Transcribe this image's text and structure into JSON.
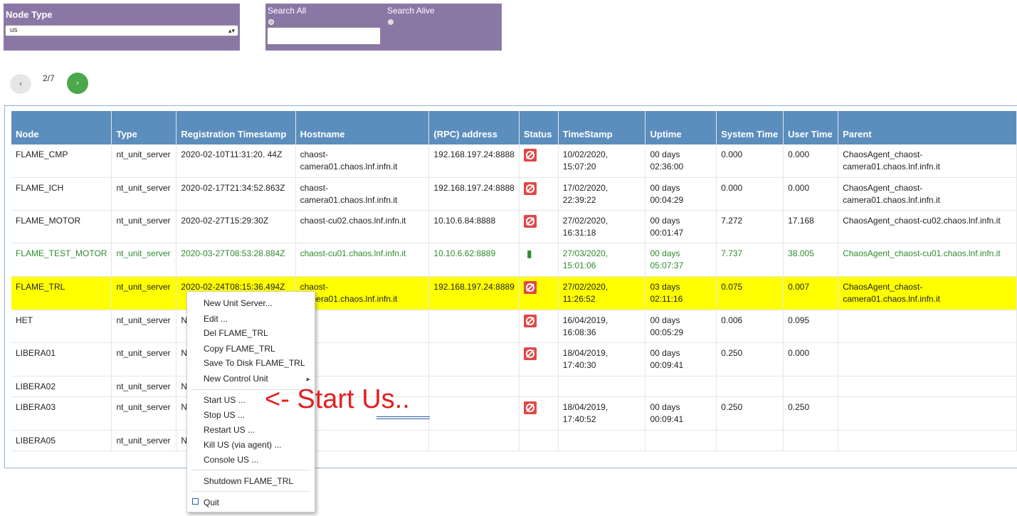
{
  "filters": {
    "node_type_label": "Node Type",
    "node_type_value": "us",
    "search_all_label": "Search All",
    "search_alive_label": "Search Alive",
    "search_value": ""
  },
  "pagination": {
    "prev": "‹",
    "page_text": "2/7",
    "next": "›"
  },
  "table": {
    "headers": [
      "Node",
      "Type",
      "Registration Timestamp",
      "Hostname",
      "(RPC) address",
      "Status",
      "TimeStamp",
      "Uptime",
      "System Time",
      "User Time",
      "Parent"
    ],
    "rows": [
      {
        "node": "FLAME_CMP",
        "type": "nt_unit_server",
        "reg": "2020-02-10T11:31:20. 44Z",
        "host": "chaost-camera01.chaos.lnf.infn.it",
        "rpc": "192.168.197.24:8888",
        "status": "stop-icon",
        "ts": "10/02/2020, 15:07:20",
        "uptime": "00 days 02:36:00",
        "sys": "0.000",
        "user": "0.000",
        "parent": "ChaosAgent_chaost-camera01.chaos.lnf.infn.it"
      },
      {
        "node": "FLAME_ICH",
        "type": "nt_unit_server",
        "reg": "2020-02-17T21:34:52.863Z",
        "host": "chaost-camera01.chaos.lnf.infn.it",
        "rpc": "192.168.197.24:8888",
        "status": "stop-icon",
        "ts": "17/02/2020, 22:39:22",
        "uptime": "00 days 00:04:29",
        "sys": "0.000",
        "user": "0.000",
        "parent": "ChaosAgent_chaost-camera01.chaos.lnf.infn.it"
      },
      {
        "node": "FLAME_MOTOR",
        "type": "nt_unit_server",
        "reg": "2020-02-27T15:29:30Z",
        "host": "chaost-cu02.chaos.lnf.infn.it",
        "rpc": "10.10.6.84:8888",
        "status": "stop-icon",
        "ts": "27/02/2020, 16:31:18",
        "uptime": "00 days 00:01:47",
        "sys": "7.272",
        "user": "17.168",
        "parent": "ChaosAgent_chaost-cu02.chaos.lnf.infn.it"
      },
      {
        "node": "FLAME_TEST_MOTOR",
        "type": "nt_unit_server",
        "reg": "2020-03-27T08:53:28.884Z",
        "host": "chaost-cu01.chaos.lnf.infn.it",
        "rpc": "10.10.6.62:8889",
        "status": "plug-icon",
        "ts": "27/03/2020, 15:01:06",
        "uptime": "00 days 05:07:37",
        "sys": "7.737",
        "user": "38.005",
        "parent": "ChaosAgent_chaost-cu01.chaos.lnf.infn.it"
      },
      {
        "node": "FLAME_TRL",
        "type": "nt_unit_server",
        "reg": "2020-02-24T08:15:36.494Z",
        "host": "chaost-camera01.chaos.lnf.infn.it",
        "rpc": "192.168.197.24:8889",
        "status": "stop-icon",
        "ts": "27/02/2020, 11:26:52",
        "uptime": "03 days 02:11:16",
        "sys": "0.075",
        "user": "0.007",
        "parent": "ChaosAgent_chaost-camera01.chaos.lnf.infn.it"
      },
      {
        "node": "HET",
        "type": "nt_unit_server",
        "reg": "NA",
        "host": "",
        "rpc": "",
        "status": "stop-icon",
        "ts": "16/04/2019, 16:08:36",
        "uptime": "00 days 00:05:29",
        "sys": "0.006",
        "user": "0.095",
        "parent": ""
      },
      {
        "node": "LIBERA01",
        "type": "nt_unit_server",
        "reg": "NA",
        "host": "",
        "rpc": "",
        "status": "stop-icon",
        "ts": "18/04/2019, 17:40:30",
        "uptime": "00 days 00:09:41",
        "sys": "0.250",
        "user": "0.000",
        "parent": ""
      },
      {
        "node": "LIBERA02",
        "type": "nt_unit_server",
        "reg": "NA",
        "host": "",
        "rpc": "",
        "status": "",
        "ts": "",
        "uptime": "",
        "sys": "",
        "user": "",
        "parent": ""
      },
      {
        "node": "LIBERA03",
        "type": "nt_unit_server",
        "reg": "NA",
        "host": "",
        "rpc": "",
        "status": "stop-icon",
        "ts": "18/04/2019, 17:40:52",
        "uptime": "00 days 00:09:41",
        "sys": "0.250",
        "user": "0.250",
        "parent": ""
      },
      {
        "node": "LIBERA05",
        "type": "nt_unit_server",
        "reg": "NA",
        "host": "",
        "rpc": "",
        "status": "",
        "ts": "",
        "uptime": "",
        "sys": "",
        "user": "",
        "parent": ""
      }
    ]
  },
  "context_menu": {
    "items": [
      "New Unit Server...",
      "Edit ...",
      "Del FLAME_TRL",
      "Copy FLAME_TRL",
      "Save To Disk FLAME_TRL",
      "New Control Unit",
      "Start US ...",
      "Stop US ...",
      "Restart US ...",
      "Kill US (via agent) ...",
      "Console US ...",
      "Shutdown FLAME_TRL",
      "Quit"
    ]
  },
  "annotation": {
    "text": "<- Start Us.."
  },
  "colors": {
    "panel": "#8b77a6",
    "header": "#5b8dbd",
    "alive": "#2e8b2e",
    "selected": "#ffff00",
    "status_stop": "#e04848",
    "annotation": "#e02020"
  }
}
